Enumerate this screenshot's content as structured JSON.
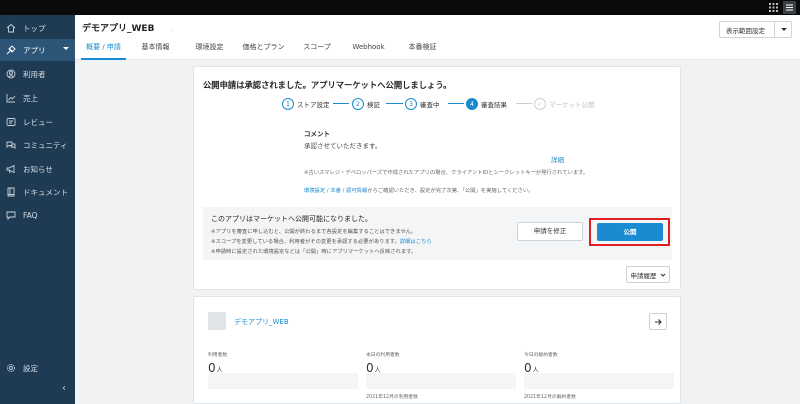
{
  "topbar": {
    "icons": [
      "grid-icon",
      "menu-icon"
    ]
  },
  "sidebar": {
    "items": [
      {
        "label": "トップ",
        "icon": "home-icon"
      },
      {
        "label": "アプリ",
        "icon": "app-icon",
        "active": true
      },
      {
        "label": "利用者",
        "icon": "user-icon"
      },
      {
        "label": "売上",
        "icon": "chart-icon"
      },
      {
        "label": "レビュー",
        "icon": "review-icon"
      },
      {
        "label": "コミュニティ",
        "icon": "community-icon"
      },
      {
        "label": "お知らせ",
        "icon": "megaphone-icon"
      },
      {
        "label": "ドキュメント",
        "icon": "book-icon"
      },
      {
        "label": "FAQ",
        "icon": "chat-icon"
      },
      {
        "label": "設定",
        "icon": "gear-icon"
      }
    ],
    "collapse_label": "‹"
  },
  "header": {
    "app_title": "デモアプリ_WEB",
    "title_mark": ".",
    "scope_button": "表示範囲設定",
    "tabs": [
      "概要 / 申請",
      "基本情報",
      "環境設定",
      "価格とプラン",
      "スコープ",
      "Webhook",
      "本番検証"
    ]
  },
  "approval": {
    "message": "公開申請は承認されました。アプリマーケットへ公開しましょう。",
    "steps": [
      {
        "num": "1",
        "label": "ストア設定",
        "state": "done"
      },
      {
        "num": "2",
        "label": "検証",
        "state": "done"
      },
      {
        "num": "3",
        "label": "審査中",
        "state": "done"
      },
      {
        "num": "4",
        "label": "審査結果",
        "state": "current"
      },
      {
        "num": "✓",
        "label": "マーケット公開",
        "state": "pending"
      }
    ],
    "comment_heading": "コメント",
    "comment_text": "承認させていただきます。",
    "detail_link": "詳細",
    "note1": "※古いスマレジ・デベロッパーズで作成されたアプリの場合、クライアントIDとシークレットキーが発行されています。",
    "note2_link": "環境設定 / 本番 / 認可情報",
    "note2_text": "からご確認いただき、設定が完了次第、「公開」を実施してください。"
  },
  "publish": {
    "title": "このアプリはマーケットへ公開可能になりました。",
    "note1": "※アプリを審査に申し込むと、公開が終わるまで各設定を編集することはできません。",
    "note2": "※スコープを変更している場合、利用者がその変更を承認する必要があります。",
    "note2_link": "詳細はこちら",
    "note3": "※申請時に設定された環境設定などは「公開」時にアプリマーケットへ反映されます。",
    "revise_button": "申請を修正",
    "publish_button": "公開",
    "history_button": "申請履歴"
  },
  "app_card": {
    "app_name": "デモアプリ_WEB",
    "stats": [
      {
        "label": "利用者数",
        "value": "0",
        "unit": "人",
        "date": ""
      },
      {
        "label": "本日の利用者数",
        "value": "0",
        "unit": "人",
        "date": "2021年12月の利用者数"
      },
      {
        "label": "今日の解約者数",
        "value": "0",
        "unit": "人",
        "date": "2021年12月の解約者数"
      }
    ]
  },
  "colors": {
    "accent": "#1a8ad1",
    "sidebar": "#1f3b53",
    "highlight": "#e02020"
  }
}
